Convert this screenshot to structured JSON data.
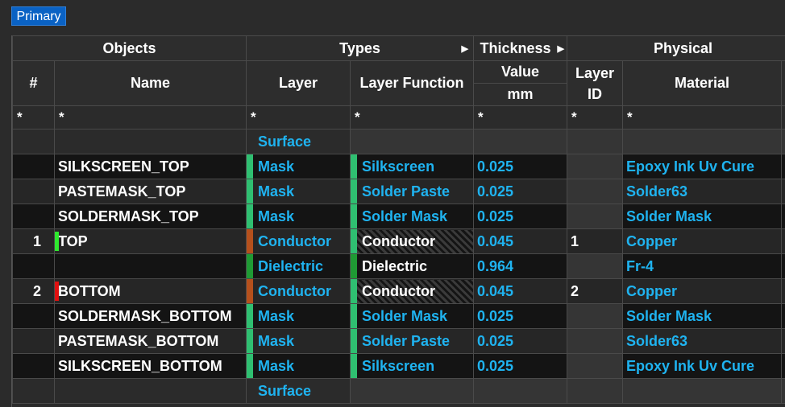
{
  "tab": {
    "label": "Primary"
  },
  "headers": {
    "objects": "Objects",
    "types": "Types",
    "thickness": "Thickness",
    "physical": "Physical",
    "num": "#",
    "name": "Name",
    "layer": "Layer",
    "layer_function": "Layer Function",
    "value": "Value",
    "unit": "mm",
    "layer_id_1": "Layer",
    "layer_id_2": "ID",
    "material": "Material"
  },
  "filter": {
    "wildcard": "*"
  },
  "colors": {
    "mask": "#2fbf71",
    "conductor": "#b5501c",
    "dielectric": "#1f9a34",
    "top": "#2ee82e",
    "bottom": "#e01010",
    "text_cyan": "#1fb3f0"
  },
  "rows": [
    {
      "num": "",
      "name": "",
      "layer": "Surface",
      "function": "",
      "value": "",
      "layer_id": "",
      "material": ""
    },
    {
      "num": "",
      "name": "SILKSCREEN_TOP",
      "layer": "Mask",
      "function": "Silkscreen",
      "value": "0.025",
      "layer_id": "",
      "material": "Epoxy Ink Uv Cure"
    },
    {
      "num": "",
      "name": "PASTEMASK_TOP",
      "layer": "Mask",
      "function": "Solder Paste",
      "value": "0.025",
      "layer_id": "",
      "material": "Solder63"
    },
    {
      "num": "",
      "name": "SOLDERMASK_TOP",
      "layer": "Mask",
      "function": "Solder Mask",
      "value": "0.025",
      "layer_id": "",
      "material": "Solder Mask"
    },
    {
      "num": "1",
      "name": "TOP",
      "layer": "Conductor",
      "function": "Conductor",
      "value": "0.045",
      "layer_id": "1",
      "material": "Copper"
    },
    {
      "num": "",
      "name": "",
      "layer": "Dielectric",
      "function": "Dielectric",
      "value": "0.964",
      "layer_id": "",
      "material": "Fr-4"
    },
    {
      "num": "2",
      "name": "BOTTOM",
      "layer": "Conductor",
      "function": "Conductor",
      "value": "0.045",
      "layer_id": "2",
      "material": "Copper"
    },
    {
      "num": "",
      "name": "SOLDERMASK_BOTTOM",
      "layer": "Mask",
      "function": "Solder Mask",
      "value": "0.025",
      "layer_id": "",
      "material": "Solder Mask"
    },
    {
      "num": "",
      "name": "PASTEMASK_BOTTOM",
      "layer": "Mask",
      "function": "Solder Paste",
      "value": "0.025",
      "layer_id": "",
      "material": "Solder63"
    },
    {
      "num": "",
      "name": "SILKSCREEN_BOTTOM",
      "layer": "Mask",
      "function": "Silkscreen",
      "value": "0.025",
      "layer_id": "",
      "material": "Epoxy Ink Uv Cure"
    },
    {
      "num": "",
      "name": "",
      "layer": "Surface",
      "function": "",
      "value": "",
      "layer_id": "",
      "material": ""
    }
  ]
}
